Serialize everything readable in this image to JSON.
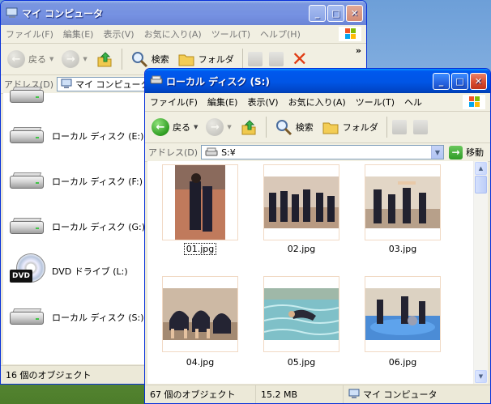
{
  "back_window": {
    "title": "マイ コンピュータ",
    "menu": [
      "ファイル(F)",
      "編集(E)",
      "表示(V)",
      "お気に入り(A)",
      "ツール(T)",
      "ヘルプ(H)"
    ],
    "toolbar": {
      "back": "戻る",
      "search": "検索",
      "folders": "フォルダ",
      "more": "»"
    },
    "address_label": "アドレス(D)",
    "address_value": "マイ コンピュータ",
    "drives": [
      {
        "label": "ローカル ディスク (E:)",
        "icon": "hard-drive-icon"
      },
      {
        "label": "ローカル ディスク (F:)",
        "icon": "hard-drive-icon"
      },
      {
        "label": "ローカル ディスク (G:)",
        "icon": "hard-drive-icon"
      },
      {
        "label": "DVD ドライブ (L:)",
        "icon": "dvd-drive-icon",
        "badge": "DVD"
      },
      {
        "label": "ローカル ディスク (S:)",
        "icon": "hard-drive-icon"
      }
    ],
    "status": "16 個のオブジェクト"
  },
  "front_window": {
    "title": "ローカル ディスク (S:)",
    "menu": [
      "ファイル(F)",
      "編集(E)",
      "表示(V)",
      "お気に入り(A)",
      "ツール(T)",
      "ヘル"
    ],
    "toolbar": {
      "back": "戻る",
      "search": "検索",
      "folders": "フォルダ",
      "more": "»"
    },
    "address_label": "アドレス(D)",
    "address_value": "S:¥",
    "go_label": "移動",
    "files": [
      {
        "name": "01.jpg",
        "selected": true
      },
      {
        "name": "02.jpg",
        "selected": false
      },
      {
        "name": "03.jpg",
        "selected": false
      },
      {
        "name": "04.jpg",
        "selected": false
      },
      {
        "name": "05.jpg",
        "selected": false
      },
      {
        "name": "06.jpg",
        "selected": false
      }
    ],
    "status": {
      "count": "67 個のオブジェクト",
      "size": "15.2 MB",
      "location": "マイ コンピュータ"
    }
  },
  "colors": {
    "title_active": "#0055e5",
    "title_inactive": "#7591e2",
    "close": "#d84c2e",
    "go": "#2e9b26"
  }
}
